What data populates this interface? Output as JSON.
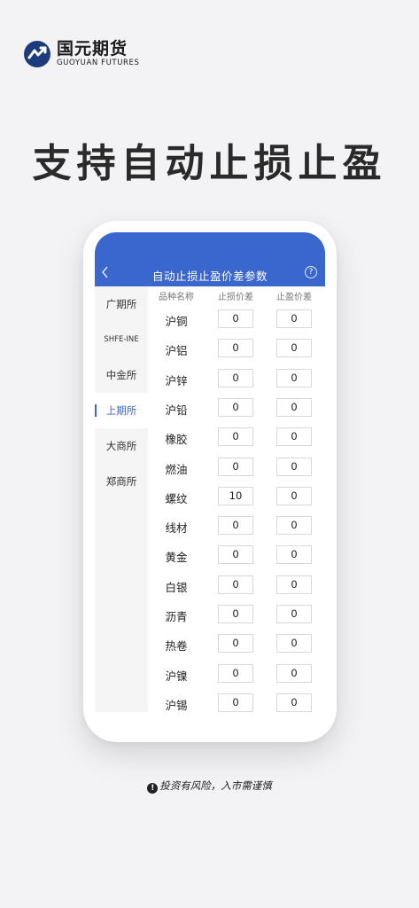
{
  "brand": {
    "name_cn": "国元期货",
    "name_en": "GUOYUAN FUTURES",
    "accent": "#3a67cd"
  },
  "headline": "支持自动止损止盈",
  "app": {
    "title": "自动止损止盈价差参数",
    "back_icon": "chevron-left-icon",
    "help_icon": "question-circle-icon",
    "help_glyph": "?"
  },
  "sidebar": {
    "active_index": 3,
    "items": [
      {
        "label": "广期所"
      },
      {
        "label": "SHFE-INE"
      },
      {
        "label": "中金所"
      },
      {
        "label": "上期所"
      },
      {
        "label": "大商所"
      },
      {
        "label": "郑商所"
      }
    ]
  },
  "table": {
    "headers": [
      "品种名称",
      "止损价差",
      "止盈价差"
    ],
    "rows": [
      {
        "name": "沪铜",
        "stop_loss": "0",
        "take_profit": "0"
      },
      {
        "name": "沪铝",
        "stop_loss": "0",
        "take_profit": "0"
      },
      {
        "name": "沪锌",
        "stop_loss": "0",
        "take_profit": "0"
      },
      {
        "name": "沪铅",
        "stop_loss": "0",
        "take_profit": "0"
      },
      {
        "name": "橡胶",
        "stop_loss": "0",
        "take_profit": "0"
      },
      {
        "name": "燃油",
        "stop_loss": "0",
        "take_profit": "0"
      },
      {
        "name": "螺纹",
        "stop_loss": "10",
        "take_profit": "0"
      },
      {
        "name": "线材",
        "stop_loss": "0",
        "take_profit": "0"
      },
      {
        "name": "黄金",
        "stop_loss": "0",
        "take_profit": "0"
      },
      {
        "name": "白银",
        "stop_loss": "0",
        "take_profit": "0"
      },
      {
        "name": "沥青",
        "stop_loss": "0",
        "take_profit": "0"
      },
      {
        "name": "热卷",
        "stop_loss": "0",
        "take_profit": "0"
      },
      {
        "name": "沪镍",
        "stop_loss": "0",
        "take_profit": "0"
      },
      {
        "name": "沪锡",
        "stop_loss": "0",
        "take_profit": "0"
      }
    ]
  },
  "disclaimer": {
    "icon": "exclamation-circle-icon",
    "glyph": "!",
    "text": "投资有风险，入市需谨慎"
  }
}
